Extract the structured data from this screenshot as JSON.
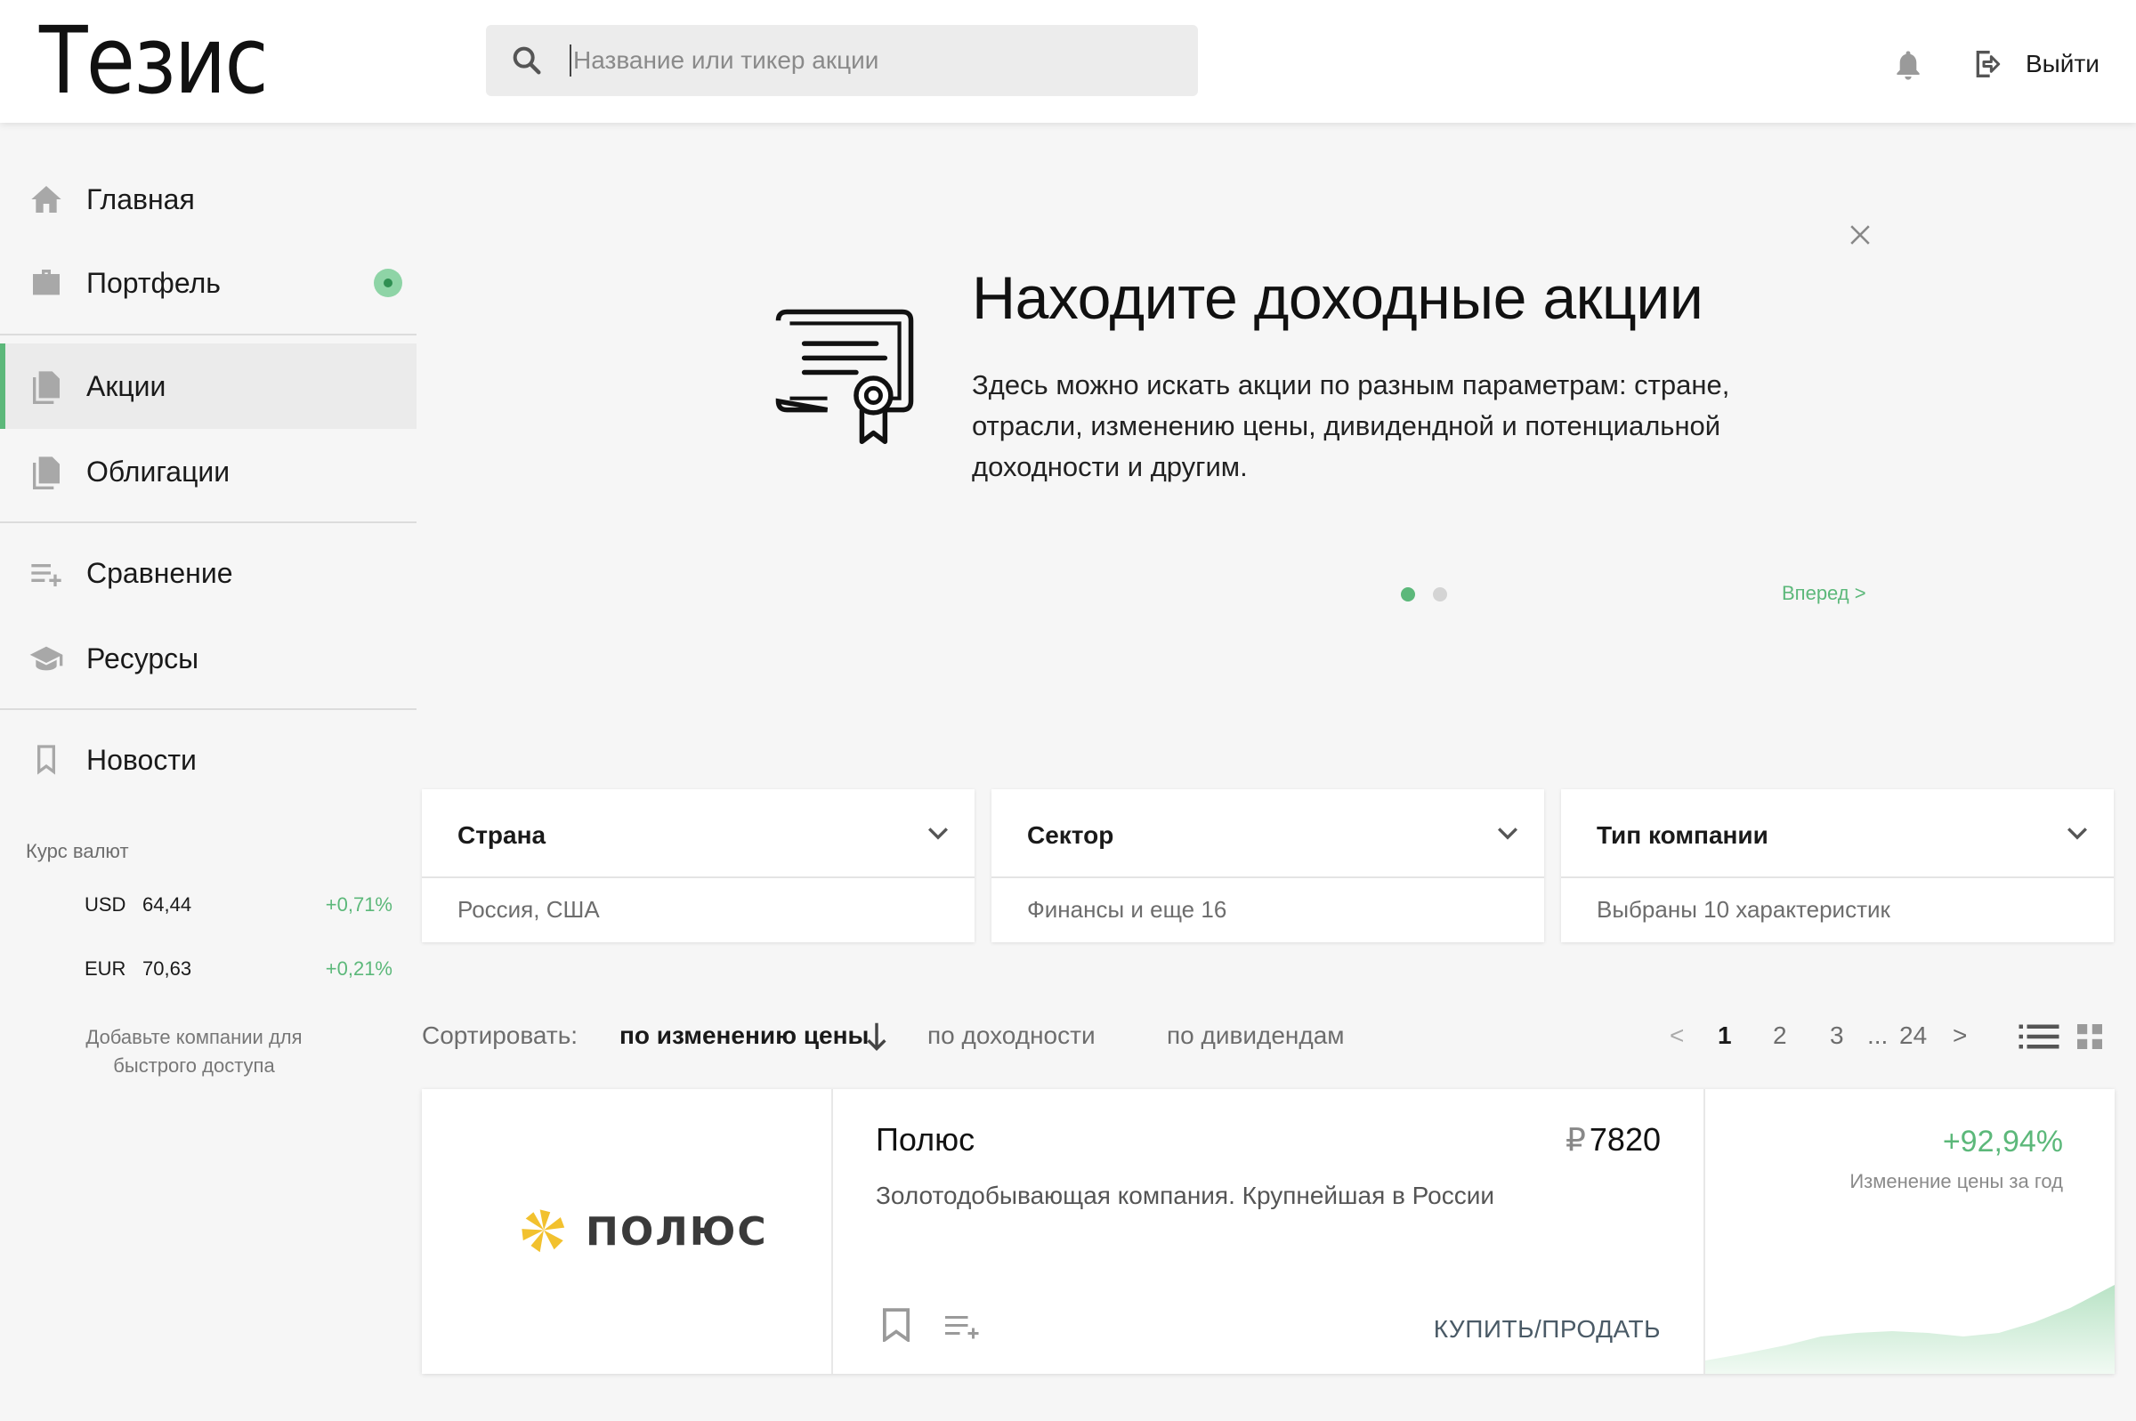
{
  "header": {
    "logo": "Тезис",
    "search_placeholder": "Название или тикер акции",
    "logout_label": "Выйти"
  },
  "sidebar": {
    "items": [
      {
        "label": "Главная",
        "icon": "home-icon"
      },
      {
        "label": "Портфель",
        "icon": "briefcase-icon",
        "badge": true
      },
      {
        "label": "Акции",
        "icon": "document-icon",
        "active": true
      },
      {
        "label": "Облигации",
        "icon": "document-icon"
      },
      {
        "label": "Сравнение",
        "icon": "compare-list-icon"
      },
      {
        "label": "Ресурсы",
        "icon": "graduation-cap-icon"
      },
      {
        "label": "Новости",
        "icon": "bookmark-icon"
      }
    ],
    "rates_title": "Курс валют",
    "rates": [
      {
        "code": "USD",
        "value": "64,44",
        "change": "+0,71%"
      },
      {
        "code": "EUR",
        "value": "70,63",
        "change": "+0,21%"
      }
    ],
    "add_hint": "Добавьте компании для быстрого доступа"
  },
  "promo": {
    "title": "Находите доходные акции",
    "text": "Здесь можно искать акции по разным параметрам: стране, отрасли, изменению цены, дивидендной и потенциальной доходности и другим.",
    "next_label": "Вперед >",
    "slides": 2,
    "active_slide": 1
  },
  "filters": [
    {
      "title": "Страна",
      "value": "Россия, США"
    },
    {
      "title": "Сектор",
      "value": "Финансы и еще 16"
    },
    {
      "title": "Тип компании",
      "value": "Выбраны 10 характеристик"
    }
  ],
  "sort": {
    "label": "Сортировать:",
    "options": [
      "по изменению цены",
      "по доходности",
      "по дивидендам"
    ],
    "active": 0
  },
  "pagination": {
    "prev": "<",
    "pages": [
      "1",
      "2",
      "3"
    ],
    "ellipsis": "...",
    "last": "24",
    "next": ">",
    "current": "1"
  },
  "stock": {
    "logo_text": "ПОЛЮС",
    "name": "Полюс",
    "currency": "₽",
    "price": "7820",
    "description": "Золотодобывающая компания. Крупнейшая в России",
    "buy_label": "КУПИТЬ/ПРОДАТЬ",
    "change": "+92,94%",
    "change_label": "Изменение цены за год"
  },
  "colors": {
    "accent": "#5cb87a",
    "logo_yellow": "#f2c12e"
  }
}
